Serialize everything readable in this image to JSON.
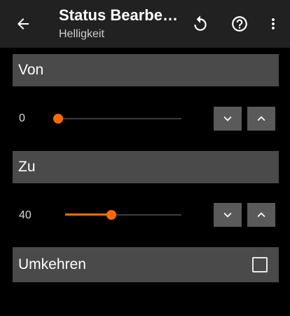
{
  "toolbar": {
    "title": "Status Bearbeiten",
    "subtitle": "Helligkeit",
    "back_icon": "arrow-back-icon",
    "reset_icon": "reset-icon",
    "help_icon": "help-circle-icon",
    "more_icon": "more-vertical-icon"
  },
  "from_section": {
    "header": "Von",
    "value_label": "0",
    "slider_fraction": 0.0
  },
  "to_section": {
    "header": "Zu",
    "value_label": "40",
    "slider_fraction": 0.4
  },
  "invert": {
    "label": "Umkehren",
    "checked": false
  },
  "colors": {
    "accent": "#ff6a00",
    "toolbar_bg": "#212121",
    "panel_bg": "#4a4a4a",
    "button_bg": "#5a5a5a"
  }
}
